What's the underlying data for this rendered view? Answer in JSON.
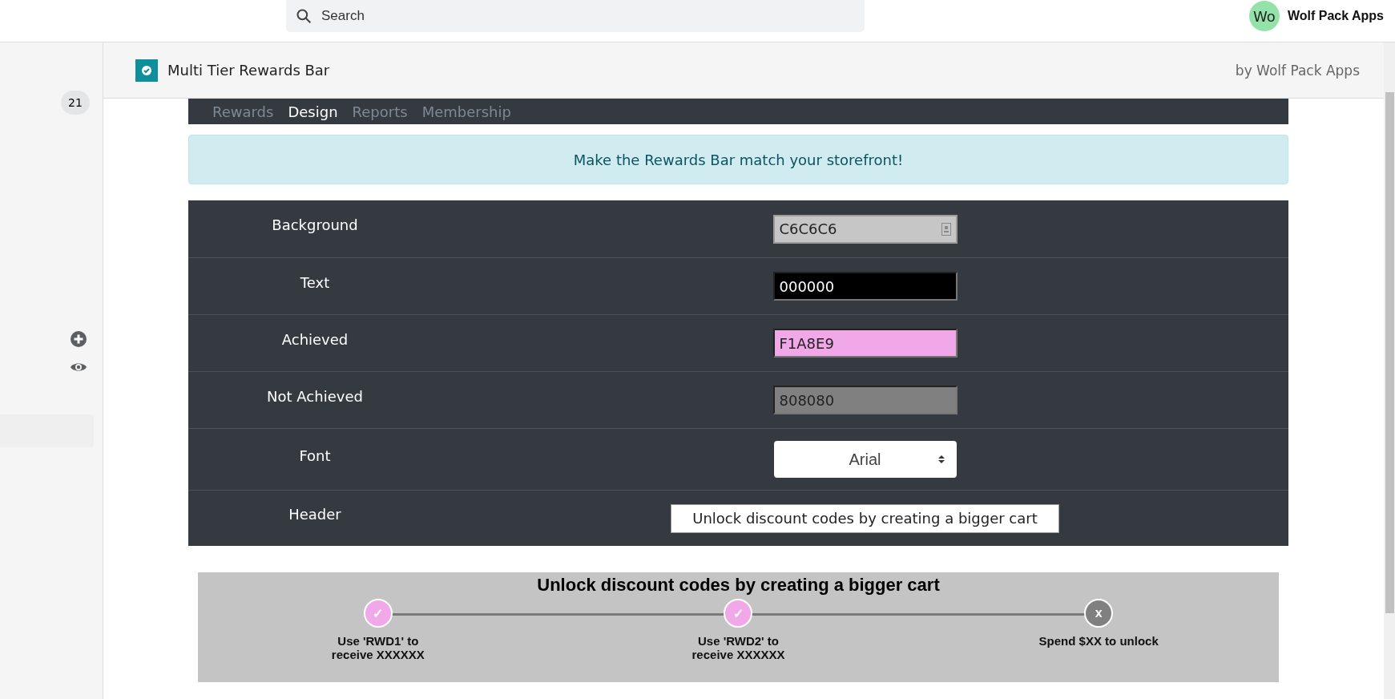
{
  "topbar": {
    "search": {
      "placeholder": "Search"
    },
    "avatar": "Wo",
    "account": "Wolf Pack Apps"
  },
  "sidebar": {
    "badge": "21"
  },
  "app_header": {
    "title": "Multi Tier Rewards Bar",
    "byline": "by Wolf Pack Apps"
  },
  "tabs": [
    {
      "label": "Rewards",
      "selected": false
    },
    {
      "label": "Design",
      "selected": true
    },
    {
      "label": "Reports",
      "selected": false
    },
    {
      "label": "Membership",
      "selected": false
    }
  ],
  "alert": "Make the Rewards Bar match your storefront!",
  "settings": [
    {
      "kind": "color",
      "label": "Background",
      "value": "C6C6C6",
      "focused": true
    },
    {
      "kind": "color",
      "label": "Text",
      "value": "000000",
      "focused": false
    },
    {
      "kind": "color",
      "label": "Achieved",
      "value": "F1A8E9",
      "focused": false
    },
    {
      "kind": "color",
      "label": "Not Achieved",
      "value": "808080",
      "focused": false
    },
    {
      "kind": "select",
      "label": "Font",
      "value": "Arial"
    },
    {
      "kind": "text",
      "label": "Header",
      "value": "Unlock discount codes by creating a bigger cart"
    }
  ],
  "preview": {
    "title": "Unlock discount codes by creating a bigger cart",
    "steps": [
      {
        "achieved": true,
        "mark": "✓",
        "label": "Use 'RWD1' to receive XXXXXX"
      },
      {
        "achieved": true,
        "mark": "✓",
        "label": "Use 'RWD2' to receive XXXXXX"
      },
      {
        "achieved": false,
        "mark": "x",
        "label": "Spend $XX to unlock"
      }
    ]
  }
}
